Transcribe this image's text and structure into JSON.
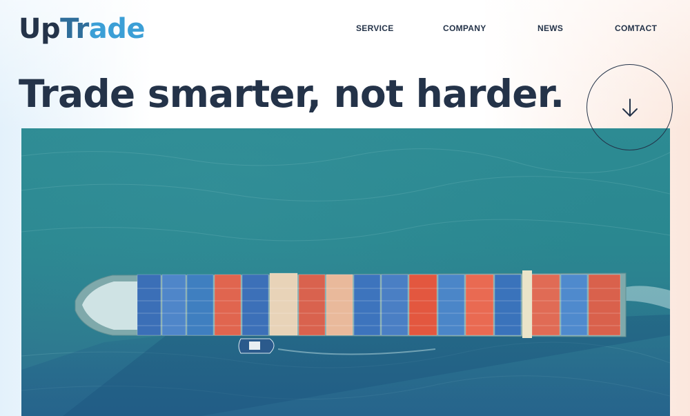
{
  "header": {
    "logo": {
      "part1": "Up",
      "part2": "Tr",
      "part3": "ade"
    },
    "nav": [
      {
        "label": "SERVICE"
      },
      {
        "label": "COMPANY"
      },
      {
        "label": "NEWS"
      },
      {
        "label": "COMTACT"
      }
    ]
  },
  "hero": {
    "headline": "Trade smarter, not harder.",
    "scroll_icon": "arrow-down-icon",
    "image_subject": "container-ship-aerial-photo"
  },
  "colors": {
    "text_dark": "#243349",
    "logo_blue_dark": "#2f6e9b",
    "logo_blue_light": "#3b9fd6",
    "sea": "#2b8790"
  }
}
